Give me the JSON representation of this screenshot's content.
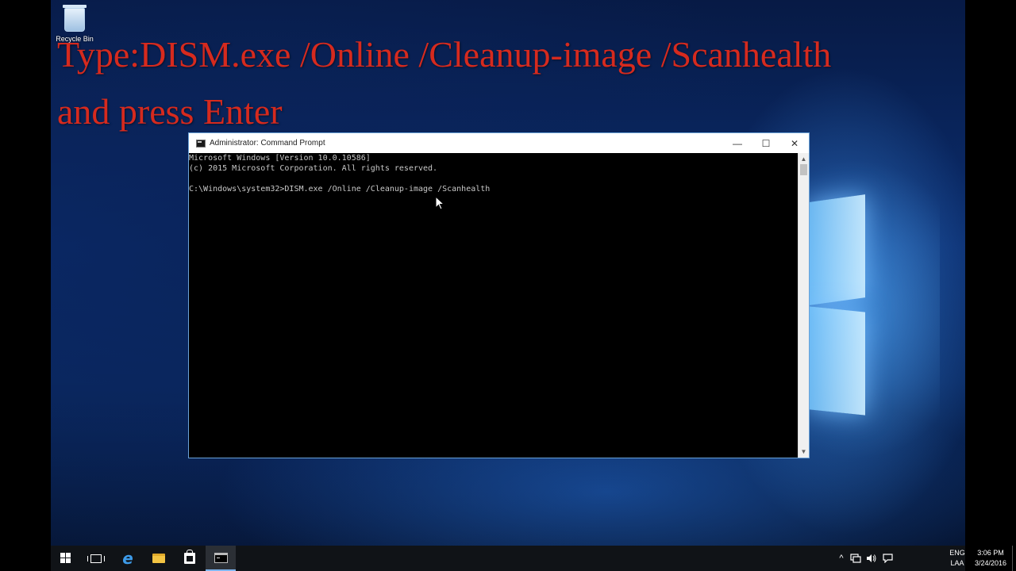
{
  "caption": {
    "line1": "Type:DISM.exe /Online /Cleanup-image /Scanhealth",
    "line2": "and press Enter"
  },
  "desktop": {
    "recycle_bin_label": "Recycle Bin"
  },
  "cmd_window": {
    "title": "Administrator: Command Prompt",
    "lines": [
      "Microsoft Windows [Version 10.0.10586]",
      "(c) 2015 Microsoft Corporation. All rights reserved.",
      "",
      "C:\\Windows\\system32>DISM.exe /Online /Cleanup-image /Scanhealth"
    ],
    "minimize_glyph": "—",
    "maximize_glyph": "☐",
    "close_glyph": "✕"
  },
  "taskbar": {
    "icons": [
      "windows-start-icon",
      "task-view-icon",
      "edge-icon",
      "file-explorer-icon",
      "store-icon",
      "command-prompt-icon"
    ],
    "edge_glyph": "e",
    "tray": {
      "chevron": "^",
      "lang_line1": "ENG",
      "lang_line2": "LAA",
      "time": "3:06 PM",
      "date": "3/24/2016"
    }
  },
  "colors": {
    "caption": "#d62a1e",
    "console_text": "#c8c8c8",
    "taskbar": "#101317",
    "window_border": "#6aa2d8"
  }
}
